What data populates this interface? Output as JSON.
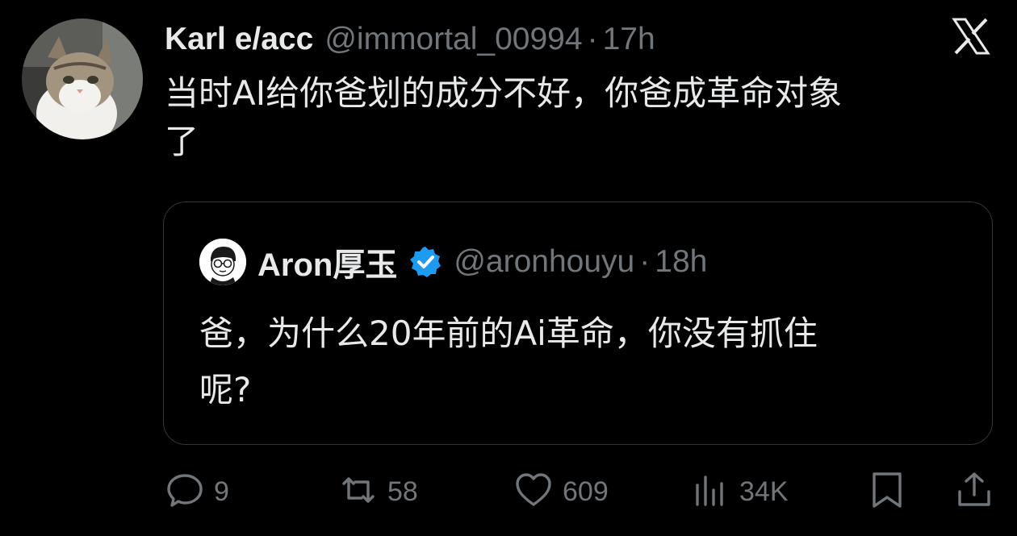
{
  "tweet": {
    "author": {
      "display_name": "Karl e/acc",
      "handle": "@immortal_00994",
      "separator": "·",
      "time": "17h"
    },
    "text_line1": "当时AI给你爸划的成分不好，你爸成革命对象",
    "text_line2": "了",
    "quote": {
      "display_name": "Aron厚玉",
      "verified": true,
      "handle": "@aronhouyu",
      "separator": "·",
      "time": "18h",
      "text_line1": "爸，为什么20年前的Ai革命，你没有抓住",
      "text_line2": "呢?"
    },
    "actions": {
      "replies": "9",
      "retweets": "58",
      "likes": "609",
      "views": "34K"
    }
  },
  "icons": {
    "logo": "x-logo-icon",
    "reply": "reply-icon",
    "retweet": "retweet-icon",
    "like": "heart-icon",
    "views": "views-icon",
    "bookmark": "bookmark-icon",
    "share": "share-icon",
    "verified": "verified-badge-icon"
  },
  "colors": {
    "background": "#000000",
    "text": "#e7e9ea",
    "secondary": "#71767b",
    "verified": "#1d9bf0",
    "border": "#333639"
  }
}
